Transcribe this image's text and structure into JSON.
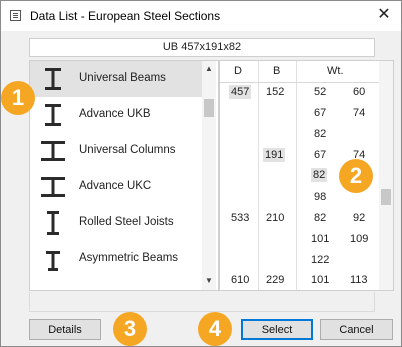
{
  "window": {
    "title": "Data List - European Steel Sections",
    "close_glyph": "✕"
  },
  "name_box": "UB 457x191x82",
  "sections": [
    {
      "label": "Universal Beams",
      "icon": "i-beam-icon",
      "selected": true
    },
    {
      "label": "Advance UKB",
      "icon": "i-beam-icon"
    },
    {
      "label": "Universal Columns",
      "icon": "h-column-icon"
    },
    {
      "label": "Advance UKC",
      "icon": "h-column-icon"
    },
    {
      "label": "Rolled Steel Joists",
      "icon": "i-beam-icon"
    },
    {
      "label": "Asymmetric Beams",
      "icon": "asymmetric-beam-icon"
    }
  ],
  "table": {
    "headers": {
      "d": "D",
      "b": "B",
      "wt": "Wt."
    },
    "cells": {
      "d1": "457",
      "b1": "152",
      "w1a": "52",
      "w1b": "60",
      "w2a": "67",
      "w2b": "74",
      "w3a": "82",
      "b2": "191",
      "w4a": "67",
      "w4b": "74",
      "w5a": "82",
      "w6a": "98",
      "d3": "533",
      "b3": "210",
      "w7a": "82",
      "w7b": "92",
      "w8a": "101",
      "w8b": "109",
      "w9a": "122",
      "d4": "610",
      "b4": "229",
      "w10a": "101",
      "w10b": "113"
    }
  },
  "buttons": {
    "details": "Details",
    "select": "Select",
    "cancel": "Cancel"
  },
  "callouts": [
    "1",
    "2",
    "3",
    "4"
  ],
  "colors": {
    "accent": "#0078d7",
    "callout": "#f5a623",
    "selection": "#e2e2e2"
  }
}
